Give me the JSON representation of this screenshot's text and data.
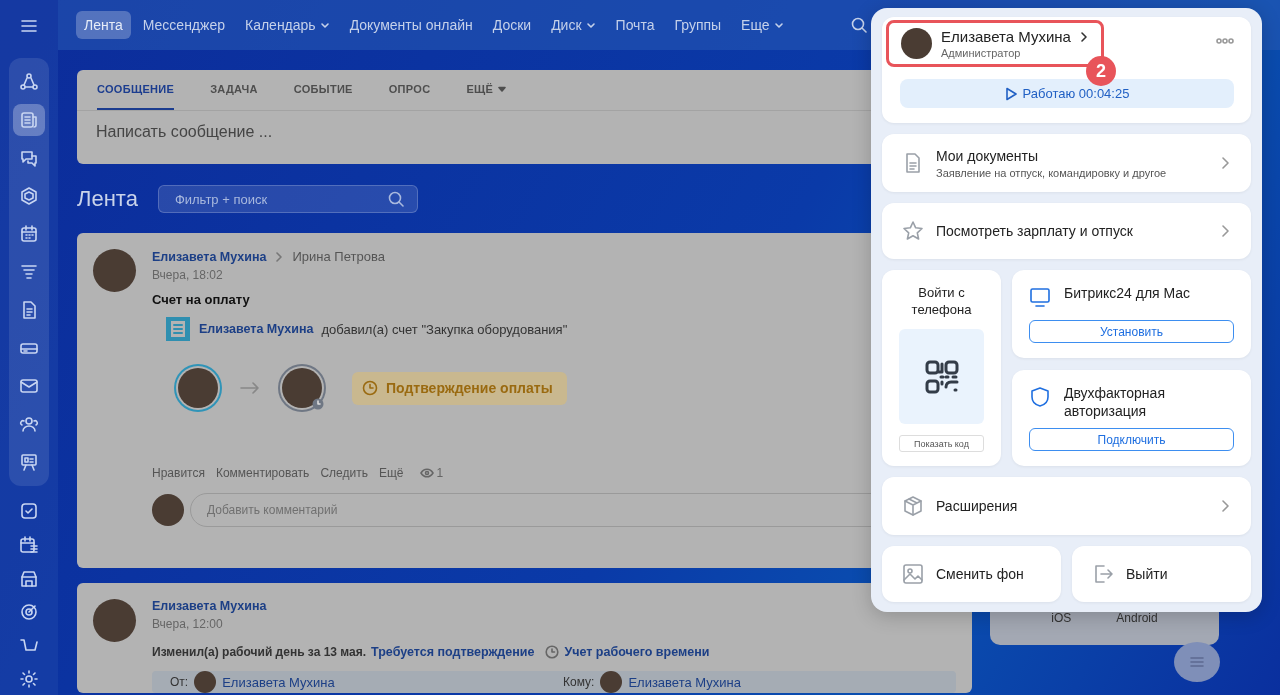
{
  "sidebar": {
    "group": [
      {
        "selected": false
      },
      {
        "selected": true
      },
      {
        "selected": false
      },
      {
        "selected": false
      },
      {
        "selected": false
      },
      {
        "selected": false
      },
      {
        "selected": false
      },
      {
        "selected": false
      },
      {
        "selected": false
      },
      {
        "selected": false
      },
      {
        "selected": false
      }
    ],
    "items": [
      {
        "selected": false
      },
      {
        "selected": false
      },
      {
        "selected": false
      },
      {
        "selected": false
      },
      {
        "selected": false
      },
      {
        "selected": false
      }
    ]
  },
  "top_nav": [
    {
      "label": "Лента",
      "selected": true,
      "dropdown": false
    },
    {
      "label": "Мессенджер",
      "selected": false,
      "dropdown": false
    },
    {
      "label": "Календарь",
      "selected": false,
      "dropdown": true
    },
    {
      "label": "Документы онлайн",
      "selected": false,
      "dropdown": false
    },
    {
      "label": "Доски",
      "selected": false,
      "dropdown": false
    },
    {
      "label": "Диск",
      "selected": false,
      "dropdown": true
    },
    {
      "label": "Почта",
      "selected": false,
      "dropdown": false
    },
    {
      "label": "Группы",
      "selected": false,
      "dropdown": false
    },
    {
      "label": "Еще",
      "selected": false,
      "dropdown": true
    }
  ],
  "composer": {
    "tabs": [
      {
        "label": "СООБЩЕНИЕ",
        "selected": true,
        "dropdown": false
      },
      {
        "label": "ЗАДАЧА",
        "selected": false,
        "dropdown": false
      },
      {
        "label": "СОБЫТИЕ",
        "selected": false,
        "dropdown": false
      },
      {
        "label": "ОПРОС",
        "selected": false,
        "dropdown": false
      },
      {
        "label": "ЕЩЁ",
        "selected": false,
        "dropdown": true
      }
    ],
    "placeholder": "Написать сообщение ..."
  },
  "feed": {
    "title": "Лента",
    "search_placeholder": "Фильтр + поиск"
  },
  "posts": [
    {
      "kind": "invoice",
      "author": "Елизавета Мухина",
      "recipient": "Ирина Петрова",
      "time": "Вчера, 18:02",
      "title": "Счет на оплату",
      "invoice": {
        "author": "Елизавета Мухина",
        "text": "добавил(а) счет \"Закупка оборудования\""
      },
      "status": "Подтверждение оплаты",
      "actions": [
        "Нравится",
        "Комментировать",
        "Следить",
        "Ещё"
      ],
      "views": "1",
      "comment_placeholder": "Добавить комментарий"
    },
    {
      "kind": "worktime",
      "author": "Елизавета Мухина",
      "time": "Вчера, 12:00",
      "text": "Изменил(а) рабочий день за 13 мая.",
      "link": "Требуется подтверждение",
      "tag": "Учет рабочего времени",
      "from_label": "От:",
      "from": "Елизавета Мухина",
      "to_label": "Кому:",
      "to": "Елизавета Мухина"
    }
  ],
  "widget": {
    "apps": [
      "iOS",
      "Android"
    ]
  },
  "profile_panel": {
    "user": {
      "name": "Елизавета Мухина",
      "role": "Администратор"
    },
    "step": "2",
    "timer": "Работаю 00:04:25",
    "documents": {
      "title": "Мои документы",
      "subtitle": "Заявление на отпуск, командировку и другое"
    },
    "salary": "Посмотреть зарплату и отпуск",
    "phone_login": {
      "title": "Войти с телефона",
      "button": "Показать код"
    },
    "mac_app": {
      "title": "Битрикс24 для Mac",
      "button": "Установить"
    },
    "two_factor": {
      "title": "Двухфакторная авторизация",
      "button": "Подключить"
    },
    "extensions": "Расширения",
    "change_background": "Сменить фон",
    "logout": "Выйти"
  }
}
